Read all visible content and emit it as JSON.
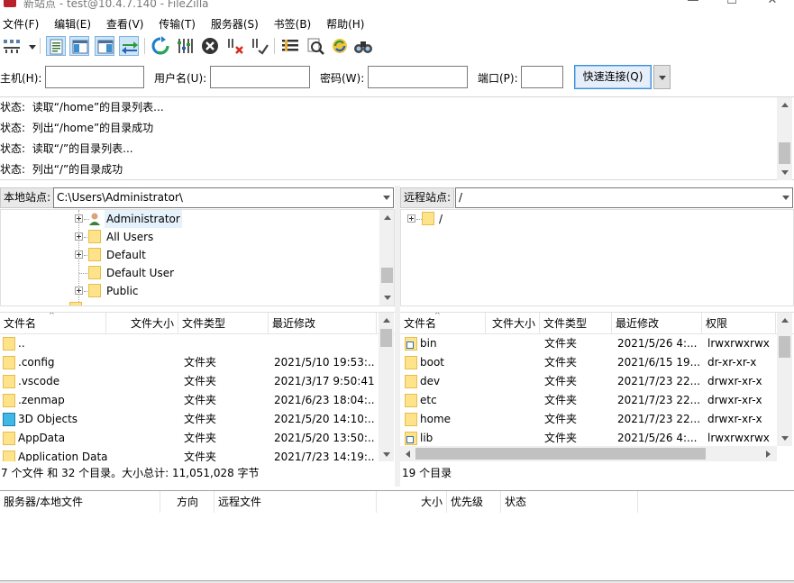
{
  "window": {
    "title": "新站点 - test@10.4.7.140 - FileZilla"
  },
  "menu": [
    "文件(F)",
    "编辑(E)",
    "查看(V)",
    "传输(T)",
    "服务器(S)",
    "书签(B)",
    "帮助(H)"
  ],
  "toolbar": [
    {
      "name": "site-manager-icon"
    },
    {
      "name": "dropdown-arrow-icon"
    },
    {
      "name": "toggle-message-log-icon"
    },
    {
      "name": "toggle-local-tree-icon"
    },
    {
      "name": "toggle-remote-tree-icon"
    },
    {
      "name": "toggle-transfer-queue-icon"
    },
    {
      "name": "refresh-icon"
    },
    {
      "name": "process-queue-icon"
    },
    {
      "name": "cancel-operation-icon"
    },
    {
      "name": "disconnect-icon"
    },
    {
      "name": "reconnect-icon"
    },
    {
      "name": "directory-filter-icon"
    },
    {
      "name": "dir-compare-icon"
    },
    {
      "name": "sync-browse-icon"
    },
    {
      "name": "search-files-icon"
    }
  ],
  "quickconnect": {
    "host_label": "主机(H):",
    "host_value": "",
    "user_label": "用户名(U):",
    "user_value": "",
    "pass_label": "密码(W):",
    "pass_value": "",
    "port_label": "端口(P):",
    "port_value": "",
    "connect_label": "快速连接(Q)"
  },
  "log": [
    {
      "key": "状态:",
      "text": "读取“/home”的目录列表..."
    },
    {
      "key": "状态:",
      "text": "列出“/home”的目录成功"
    },
    {
      "key": "状态:",
      "text": "读取“/”的目录列表..."
    },
    {
      "key": "状态:",
      "text": "列出“/”的目录成功"
    }
  ],
  "local": {
    "site_label": "本地站点:",
    "path": "C:\\Users\\Administrator\\",
    "tree": [
      "Administrator",
      "All Users",
      "Default",
      "Default User",
      "Public"
    ],
    "columns": [
      "文件名",
      "文件大小",
      "文件类型",
      "最近修改"
    ],
    "files": [
      {
        "name": "..",
        "size": "",
        "type": "",
        "modified": "",
        "icon": "folder"
      },
      {
        "name": ".config",
        "size": "",
        "type": "文件夹",
        "modified": "2021/5/10 19:53:...",
        "icon": "folder"
      },
      {
        "name": ".vscode",
        "size": "",
        "type": "文件夹",
        "modified": "2021/3/17 9:50:41",
        "icon": "folder"
      },
      {
        "name": ".zenmap",
        "size": "",
        "type": "文件夹",
        "modified": "2021/6/23 18:04:...",
        "icon": "folder"
      },
      {
        "name": "3D Objects",
        "size": "",
        "type": "文件夹",
        "modified": "2021/5/20 14:10:...",
        "icon": "cube"
      },
      {
        "name": "AppData",
        "size": "",
        "type": "文件夹",
        "modified": "2021/5/20 13:50:...",
        "icon": "folder"
      },
      {
        "name": "Application Data",
        "size": "",
        "type": "文件夹",
        "modified": "2021/7/23 14:19:...",
        "icon": "folder"
      }
    ],
    "status": "7 个文件 和 32 个目录。大小总计: 11,051,028 字节"
  },
  "remote": {
    "site_label": "远程站点:",
    "path": "/",
    "tree": [
      "/"
    ],
    "columns": [
      "文件名",
      "文件大小",
      "文件类型",
      "最近修改",
      "权限"
    ],
    "files": [
      {
        "name": "bin",
        "size": "",
        "type": "文件夹",
        "modified": "2021/5/26 4:...",
        "perm": "lrwxrwxrwx",
        "icon": "link"
      },
      {
        "name": "boot",
        "size": "",
        "type": "文件夹",
        "modified": "2021/6/15 19...",
        "perm": "dr-xr-xr-x",
        "icon": "folder"
      },
      {
        "name": "dev",
        "size": "",
        "type": "文件夹",
        "modified": "2021/7/23 22...",
        "perm": "drwxr-xr-x",
        "icon": "folder"
      },
      {
        "name": "etc",
        "size": "",
        "type": "文件夹",
        "modified": "2021/7/23 22...",
        "perm": "drwxr-xr-x",
        "icon": "folder"
      },
      {
        "name": "home",
        "size": "",
        "type": "文件夹",
        "modified": "2021/7/23 22...",
        "perm": "drwxr-xr-x",
        "icon": "folder"
      },
      {
        "name": "lib",
        "size": "",
        "type": "文件夹",
        "modified": "2021/5/26 4:...",
        "perm": "lrwxrwxrwx",
        "icon": "link"
      }
    ],
    "status": "19 个目录"
  },
  "queue": {
    "columns": [
      "服务器/本地文件",
      "方向",
      "远程文件",
      "大小",
      "优先级",
      "状态"
    ]
  }
}
